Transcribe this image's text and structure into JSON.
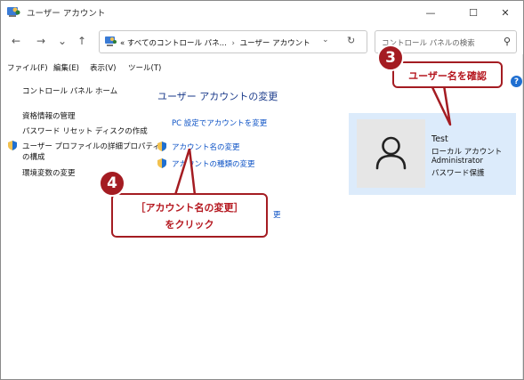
{
  "window": {
    "title": "ユーザー アカウント",
    "minimize_glyph": "—",
    "maximize_glyph": "☐",
    "close_glyph": "✕"
  },
  "nav": {
    "back_glyph": "←",
    "forward_glyph": "→",
    "recent_glyph": "⌄",
    "up_glyph": "↑"
  },
  "address": {
    "prefix": "«",
    "crumb1": "すべてのコントロール パネ...",
    "separator": "›",
    "crumb2": "ユーザー アカウント",
    "dropdown_glyph": "⌄",
    "refresh_glyph": "↻"
  },
  "search": {
    "placeholder": "コントロール パネルの検索",
    "icon_glyph": "⚲"
  },
  "menu": {
    "file": "ファイル(F)",
    "edit": "編集(E)",
    "view": "表示(V)",
    "tools": "ツール(T)"
  },
  "left_nav": {
    "home": "コントロール パネル ホーム",
    "credentials": "資格情報の管理",
    "reset_disk": "パスワード リセット ディスクの作成",
    "profile_line1": "ユーザー プロファイルの詳細プロパティ",
    "profile_line2": "の構成",
    "env_vars": "環境変数の変更"
  },
  "main": {
    "heading": "ユーザー アカウントの変更",
    "pc_settings": "PC 設定でアカウントを変更",
    "change_name": "アカウント名の変更",
    "change_type": "アカウントの種類の変更",
    "partial_link": "更"
  },
  "account": {
    "name": "Test",
    "type": "ローカル アカウント",
    "role": "Administrator",
    "protection": "パスワード保護"
  },
  "callouts": {
    "c3_number": "3",
    "c3_text": "ユーザー名を確認",
    "c4_number": "4",
    "c4_line1": "［アカウント名の変更］",
    "c4_line2": "をクリック"
  },
  "help": {
    "glyph": "?"
  },
  "colors": {
    "callout_red": "#a41c22",
    "link_blue": "#0b51c5",
    "heading_blue": "#1a3a8a",
    "tile_blue": "#dcebfb"
  }
}
